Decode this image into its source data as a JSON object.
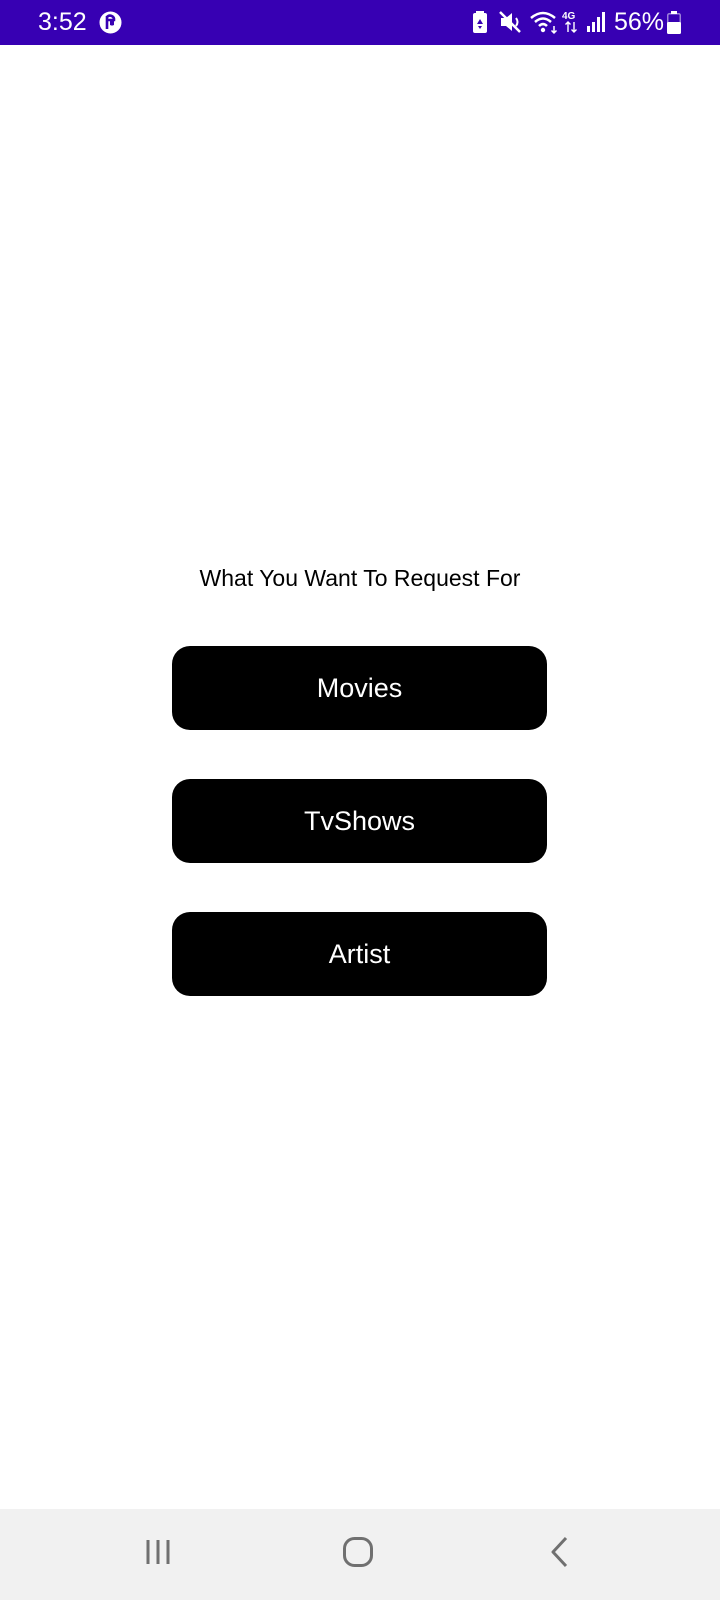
{
  "status_bar": {
    "time": "3:52",
    "battery_percent": "56%",
    "app_icon": "pinwheel-icon",
    "icons": [
      "battery-saver-icon",
      "mute-icon",
      "wifi-icon",
      "4g-icon",
      "signal-icon",
      "battery-icon"
    ],
    "background_color": "#3700b3"
  },
  "main": {
    "prompt": "What You Want To Request For",
    "buttons": [
      {
        "label": "Movies"
      },
      {
        "label": "TvShows"
      },
      {
        "label": "Artist"
      }
    ],
    "button_color": "#000000",
    "button_text_color": "#ffffff"
  },
  "nav_bar": {
    "buttons": [
      "recents-icon",
      "home-icon",
      "back-icon"
    ],
    "background_color": "#f1f1f1"
  }
}
